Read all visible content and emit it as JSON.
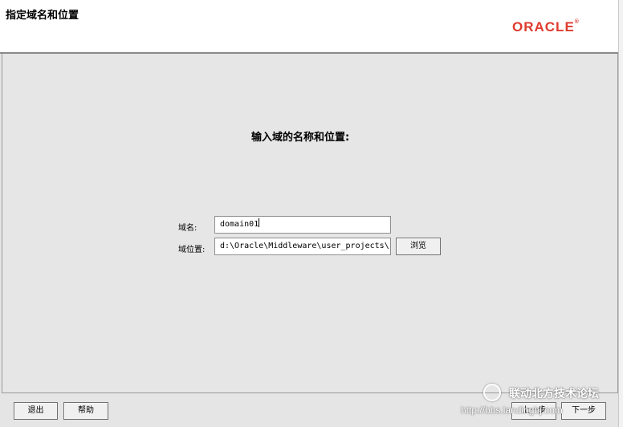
{
  "header": {
    "title": "指定域名和位置",
    "logo_text": "ORACLE",
    "logo_mark": "®"
  },
  "main": {
    "heading": "输入域的名称和位置:",
    "domain_name_label": "域名:",
    "domain_name_value": "domain01",
    "domain_location_label": "域位置:",
    "domain_location_value": "d:\\Oracle\\Middleware\\user_projects\\",
    "browse_label": "浏览"
  },
  "footer": {
    "exit_label": "退出",
    "help_label": "帮助",
    "previous_label": "上一步",
    "next_label": "下一步"
  },
  "watermark": {
    "title": "联动北方技术论坛",
    "url": "http://bbs.landingbj.com"
  },
  "colors": {
    "oracle_red": "#e03a2f",
    "background": "#e6e6e6"
  }
}
